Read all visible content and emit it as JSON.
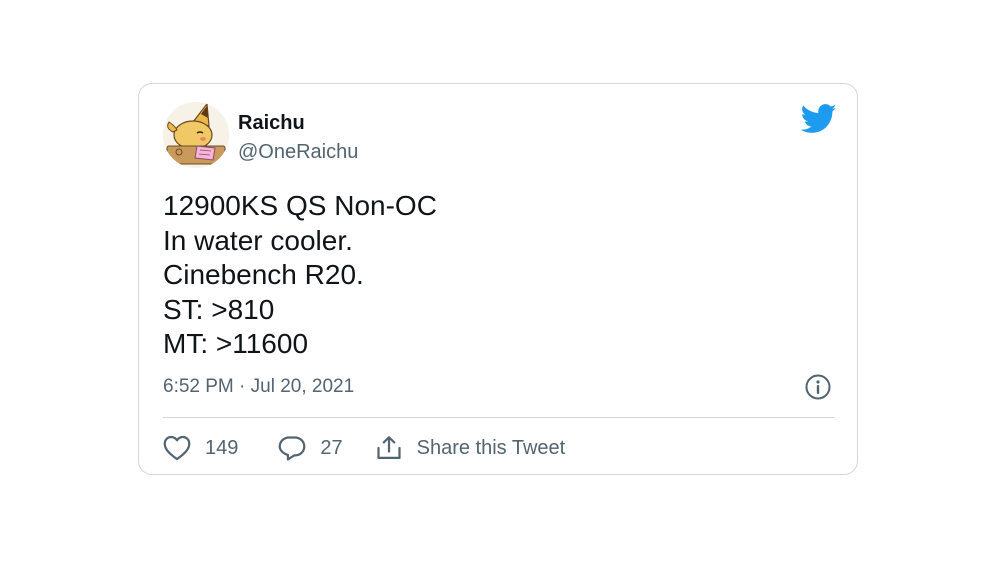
{
  "tweet": {
    "author_name": "Raichu",
    "author_handle": "@OneRaichu",
    "lines": [
      "12900KS QS Non-OC",
      "In water cooler.",
      "Cinebench R20.",
      "ST: >810",
      "MT: >11600"
    ],
    "timestamp": "6:52 PM · Jul 20, 2021",
    "likes": "149",
    "replies": "27",
    "share_label": "Share this Tweet"
  },
  "icons": {
    "brand": "twitter-bird-icon",
    "info": "info-icon",
    "like": "heart-icon",
    "reply": "reply-bubble-icon",
    "share": "share-icon"
  },
  "colors": {
    "brand": "#1d9bf0",
    "text": "#0f1419",
    "muted": "#536471",
    "border": "#cfd9de"
  }
}
